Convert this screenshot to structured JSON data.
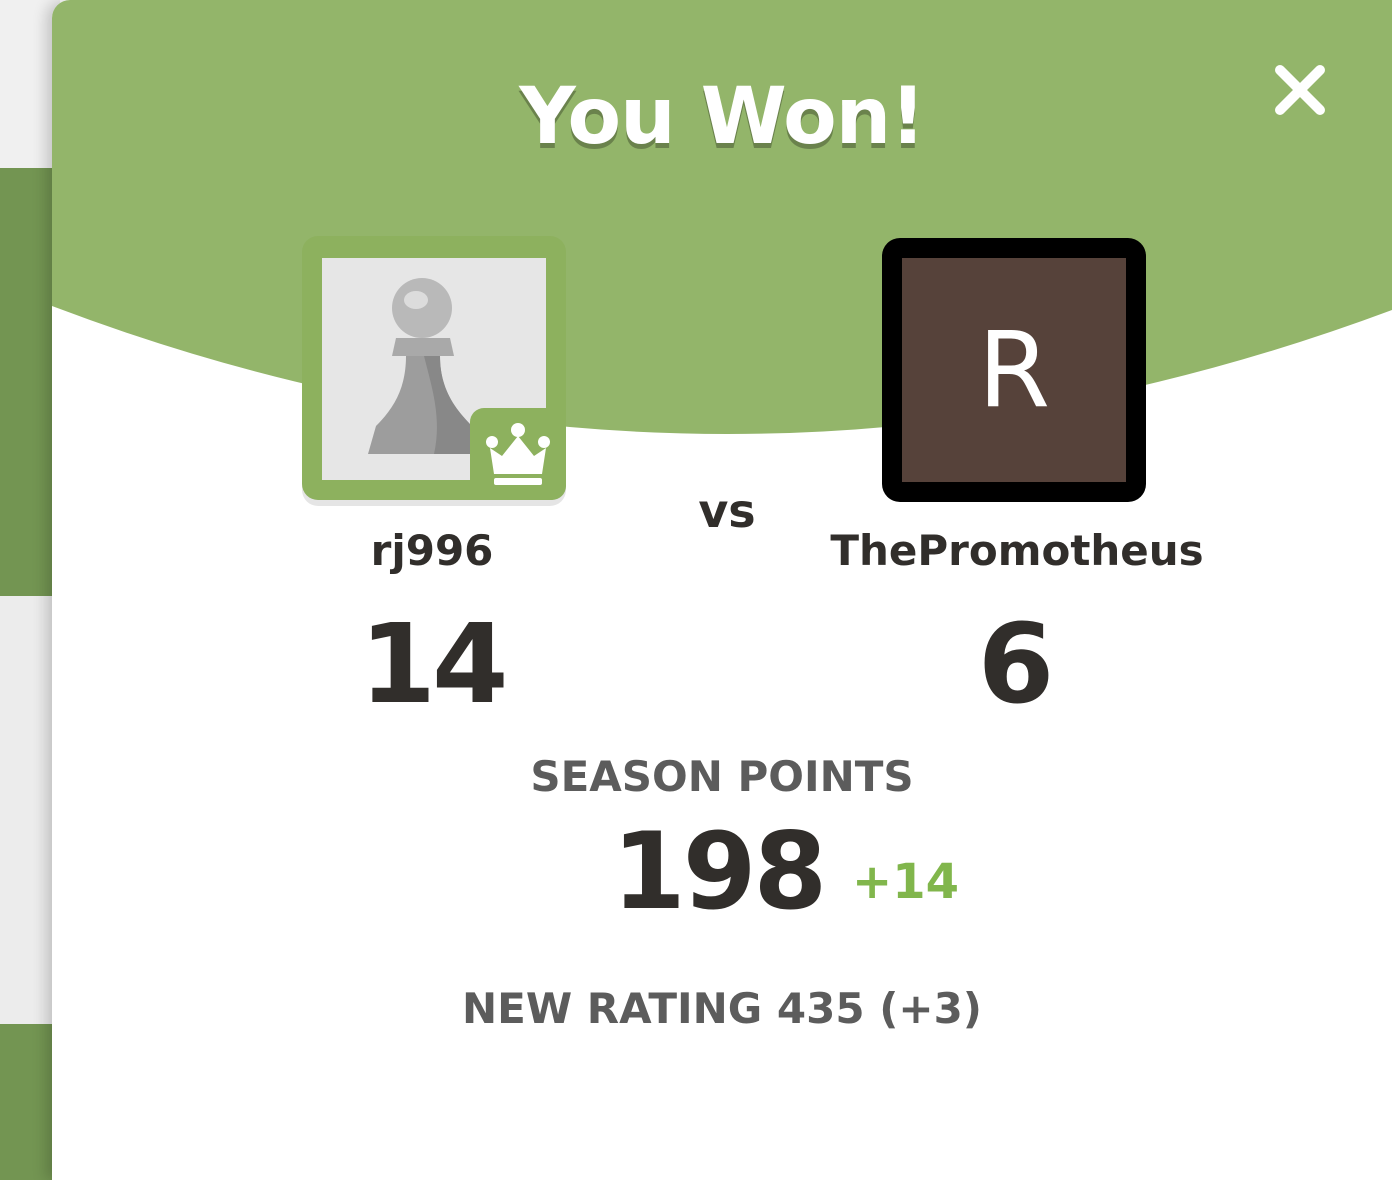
{
  "modal": {
    "title": "You Won!",
    "vs_label": "vs",
    "header_color": "#93b56a"
  },
  "players": {
    "left": {
      "name": "rj996",
      "score": "14",
      "avatar_icon": "pawn-icon",
      "badge_icon": "crown-icon",
      "accent_color": "#8db15e"
    },
    "right": {
      "name": "ThePromotheus",
      "score": "6",
      "avatar_letter": "R",
      "avatar_color": "#56423a"
    }
  },
  "season": {
    "label": "SEASON POINTS",
    "value": "198",
    "delta": "+14",
    "delta_color": "#81b64c"
  },
  "rating": {
    "text": "NEW RATING 435 (+3)"
  }
}
